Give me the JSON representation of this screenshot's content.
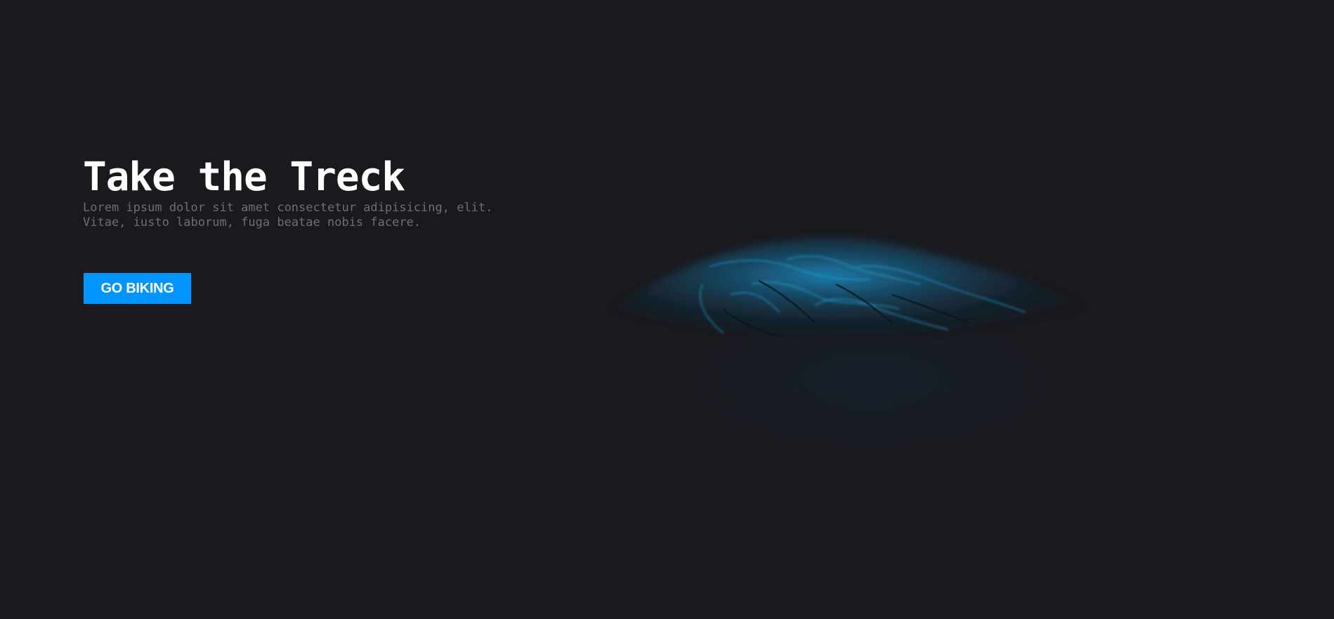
{
  "hero": {
    "title": "Take the Treck",
    "subtitle_line1": "Lorem ipsum dolor sit amet consectetur adipisicing, elit.",
    "subtitle_line2": "Vitae, iusto laborum, fuga beatae nobis facere.",
    "cta_label": "GO BIKING"
  },
  "colors": {
    "background": "#1a191e",
    "title": "#ffffff",
    "subtitle": "#6f6e74",
    "cta_background": "#0395ff",
    "mountain_highlight": "#1b84b8"
  }
}
